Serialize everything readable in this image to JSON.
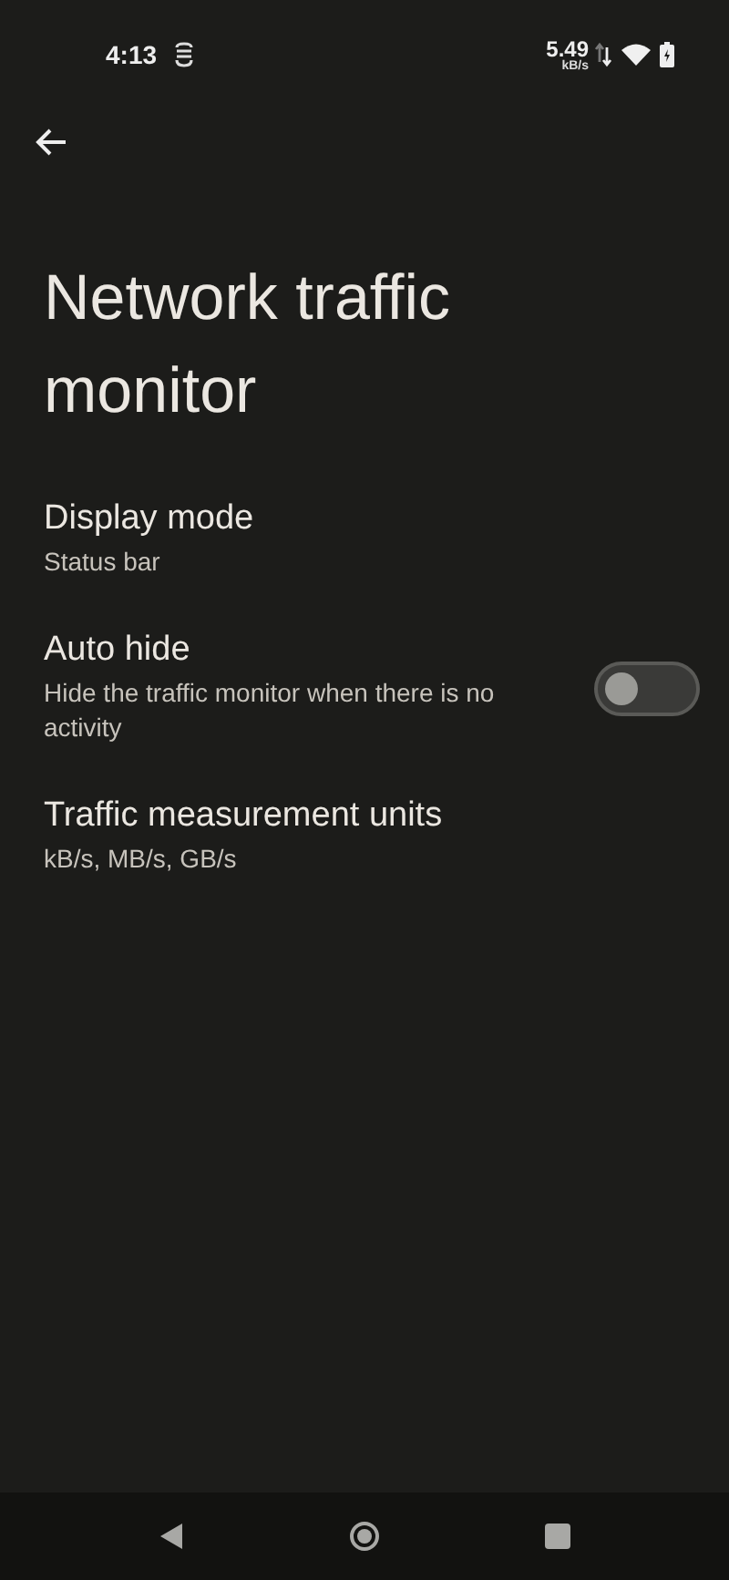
{
  "status_bar": {
    "time": "4:13",
    "speed_value": "5.49",
    "speed_unit": "kB/s"
  },
  "title": "Network traffic monitor",
  "settings": [
    {
      "kind": "text",
      "title": "Display mode",
      "summary": "Status bar"
    },
    {
      "kind": "switch",
      "title": "Auto hide",
      "summary": "Hide the traffic monitor when there is no activity",
      "on": false
    },
    {
      "kind": "text",
      "title": "Traffic measurement units",
      "summary": "kB/s, MB/s, GB/s"
    }
  ]
}
